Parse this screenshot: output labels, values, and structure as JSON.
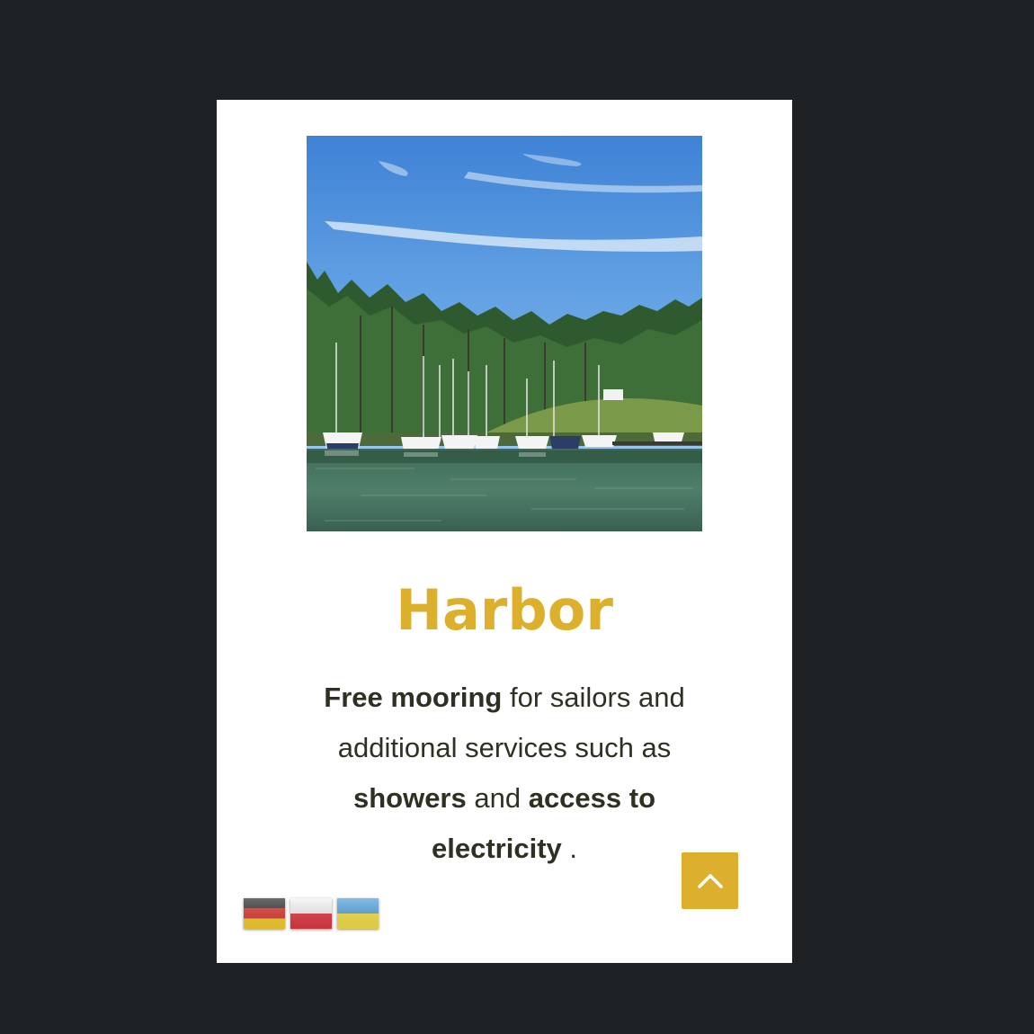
{
  "card": {
    "title": "Harbor",
    "description": {
      "bold_1": "Free mooring",
      "text_1": " for sailors and additional services such as ",
      "bold_2": "showers",
      "text_2": " and ",
      "bold_3": "access to electricity",
      "text_3": " ."
    },
    "photo": {
      "subject": "marina-with-sailboats-on-lake"
    }
  },
  "languages": [
    {
      "code": "de",
      "icon": "german-flag-icon",
      "colors": [
        "#3a3a3a",
        "#dd3a35",
        "#f7cf2e"
      ]
    },
    {
      "code": "pl",
      "icon": "polish-flag-icon",
      "colors": [
        "#f5f5f5",
        "#e03a44"
      ]
    },
    {
      "code": "uk",
      "icon": "ukrainian-flag-icon",
      "colors": [
        "#5aa8de",
        "#f7e24a"
      ]
    }
  ],
  "scroll_top": {
    "icon": "chevron-up-icon"
  },
  "colors": {
    "page_background": "#1f2225",
    "card_background": "#ffffff",
    "accent": "#dcb02c",
    "text": "#2c3122"
  }
}
